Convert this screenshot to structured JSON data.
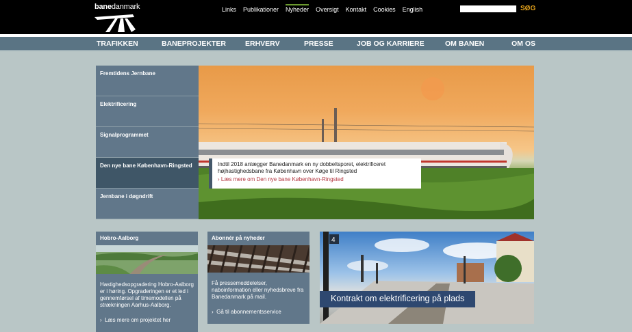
{
  "header": {
    "logo_text": "banedanmark",
    "logo_bold": "bane",
    "logo_thin": "danmark",
    "top_links": [
      "Links",
      "Publikationer",
      "Nyheder",
      "Oversigt",
      "Kontakt",
      "Cookies",
      "English"
    ],
    "active_link": "Nyheder",
    "search_value": "",
    "search_button": "SØG"
  },
  "nav": {
    "items": [
      "TRAFIKKEN",
      "BANEPROJEKTER",
      "ERHVERV",
      "PRESSE",
      "JOB OG KARRIERE",
      "OM BANEN",
      "OM OS"
    ]
  },
  "hero": {
    "menu": [
      "Fremtidens Jernbane",
      "Elektrificering",
      "Signalprogrammet",
      "Den nye bane København-Ringsted",
      "Jernbane i døgndrift"
    ],
    "active_index": 3,
    "caption_text": "Indtil 2018 anlægger Banedanmark en ny dobbeltsporet, elektrificeret højhastighedsbane fra København over Køge til Ringsted",
    "caption_link": "Læs mere om Den nye bane København-Ringsted"
  },
  "boxes": {
    "hobro": {
      "title": "Hobro-Aalborg",
      "body": "Hastighedsopgradering Hobro-Aalborg er i høring. Opgraderingen er et led i gennemførsel af timemodellen på strækningen Aarhus-Aalborg.",
      "link": "Læs mere om projektet her"
    },
    "subscribe": {
      "title": "Abonnér på nyheder",
      "body": "Få pressemeddelelser, naboinformation eller nyhedsbreve fra Banedanmark på mail.",
      "link": "Gå til abonnementsservice"
    },
    "contract": {
      "banner": "Kontrakt om elektrificering på plads",
      "platform_sign": "4"
    }
  },
  "colors": {
    "nav_bg": "#5a7484",
    "accent_search": "#e8a51c",
    "link_red": "#b3343f",
    "page_bg": "#b9c6c6"
  }
}
